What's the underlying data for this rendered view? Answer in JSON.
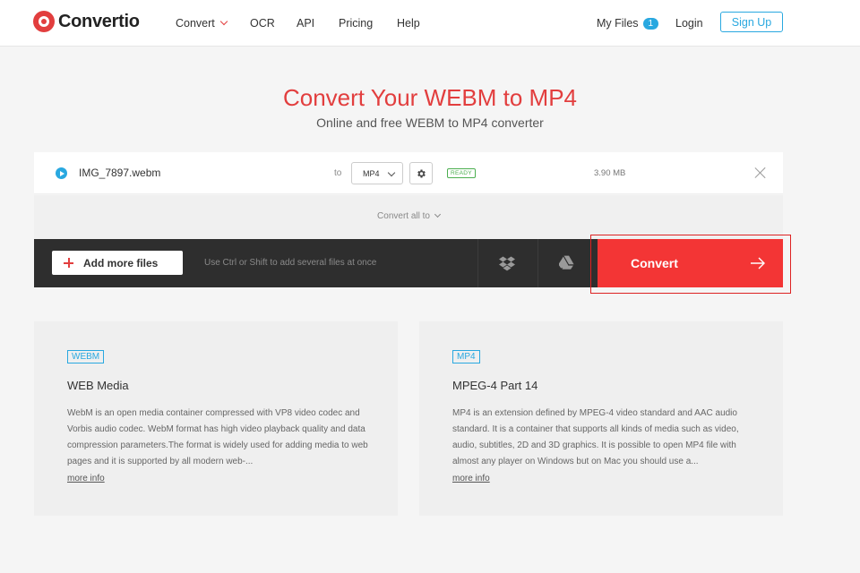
{
  "header": {
    "logo_text": "Convertio",
    "nav": {
      "convert": "Convert",
      "ocr": "OCR",
      "api": "API",
      "pricing": "Pricing",
      "help": "Help"
    },
    "my_files": "My Files",
    "my_files_count": "1",
    "login": "Login",
    "signup": "Sign Up"
  },
  "hero": {
    "title": "Convert Your WEBM to MP4",
    "subtitle": "Online and free WEBM to MP4 converter"
  },
  "file": {
    "name": "IMG_7897.webm",
    "to_label": "to",
    "target_format": "MP4",
    "status": "READY",
    "size": "3.90 MB"
  },
  "convert_all_label": "Convert all to",
  "action_bar": {
    "add_files": "Add more files",
    "hint": "Use Ctrl or Shift to add several files at once",
    "convert": "Convert"
  },
  "cards": [
    {
      "tag": "WEBM",
      "title": "WEB Media",
      "description": "WebM is an open media container compressed with VP8 video codec and Vorbis audio codec. WebM format has high video playback quality and data compression parameters.The format is widely used for adding media to web pages and it is supported by all modern web-...",
      "more_info": "more info"
    },
    {
      "tag": "MP4",
      "title": "MPEG-4 Part 14",
      "description": "MP4 is an extension defined by MPEG-4 video standard and AAC audio standard. It is a container that supports all kinds of media such as video, audio, subtitles, 2D and 3D graphics. It is possible to open MP4 file with almost any player on Windows but on Mac you should use a...",
      "more_info": "more info"
    }
  ],
  "colors": {
    "brand_red": "#e23e3e",
    "convert_red": "#f33535",
    "accent_blue": "#29a8e0",
    "ready_green": "#4caf50",
    "bar_dark": "#2e2e2e"
  }
}
